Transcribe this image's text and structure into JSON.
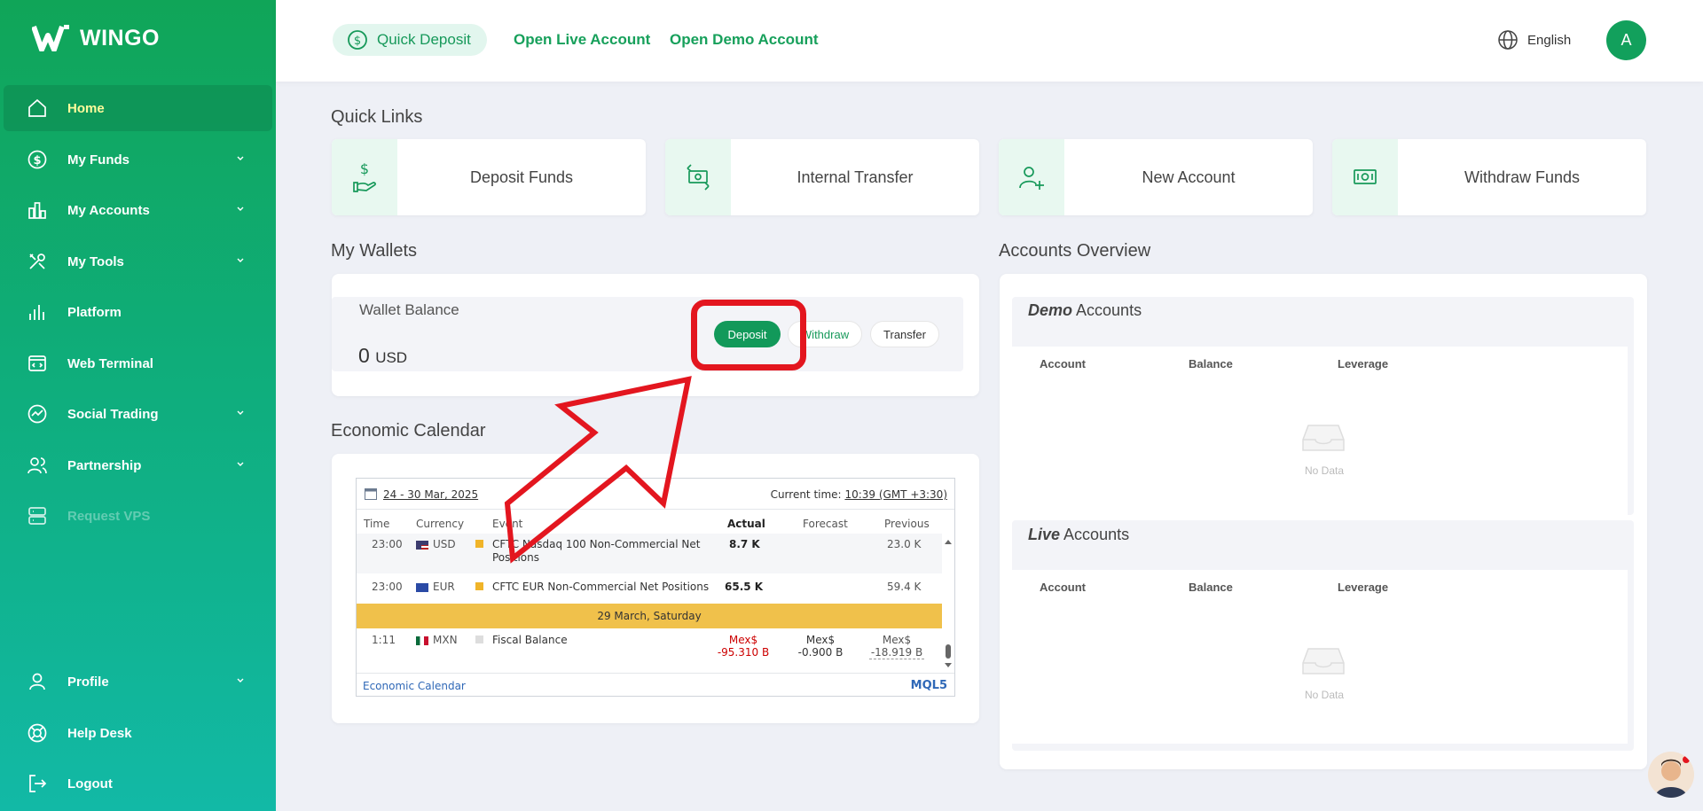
{
  "brand": {
    "name": "WINGO"
  },
  "sidebar": {
    "items": [
      {
        "label": "Home",
        "icon": "home-icon",
        "active": true,
        "expandable": false
      },
      {
        "label": "My Funds",
        "icon": "dollar-circle-icon",
        "expandable": true
      },
      {
        "label": "My Accounts",
        "icon": "bar-chart-icon",
        "expandable": true
      },
      {
        "label": "My Tools",
        "icon": "tools-icon",
        "expandable": true
      },
      {
        "label": "Platform",
        "icon": "signal-bars-icon",
        "expandable": false
      },
      {
        "label": "Web Terminal",
        "icon": "terminal-icon",
        "expandable": false
      },
      {
        "label": "Social Trading",
        "icon": "trend-icon",
        "expandable": true
      },
      {
        "label": "Partnership",
        "icon": "users-icon",
        "expandable": true
      },
      {
        "label": "Request VPS",
        "icon": "server-icon",
        "disabled": true,
        "expandable": false
      },
      {
        "label": "Profile",
        "icon": "user-icon",
        "expandable": true
      },
      {
        "label": "Help Desk",
        "icon": "lifebuoy-icon",
        "expandable": false
      },
      {
        "label": "Logout",
        "icon": "logout-icon",
        "expandable": false
      }
    ]
  },
  "header": {
    "quick_deposit": "Quick Deposit",
    "open_live": "Open Live Account",
    "open_demo": "Open Demo Account",
    "language": "English",
    "avatar_initial": "A"
  },
  "quick_links": {
    "title": "Quick Links",
    "items": [
      {
        "label": "Deposit Funds",
        "icon": "deposit-hand-icon"
      },
      {
        "label": "Internal Transfer",
        "icon": "transfer-icon"
      },
      {
        "label": "New Account",
        "icon": "add-user-icon"
      },
      {
        "label": "Withdraw Funds",
        "icon": "cash-icon"
      }
    ]
  },
  "wallets": {
    "title": "My Wallets",
    "balance_label": "Wallet Balance",
    "balance_amount": "0",
    "balance_currency": "USD",
    "deposit": "Deposit",
    "withdraw": "Withdraw",
    "transfer": "Transfer"
  },
  "calendar": {
    "title": "Economic Calendar",
    "range": "24 - 30 Mar, 2025",
    "current_time_label": "Current time:",
    "current_time": "10:39 (GMT +3:30)",
    "headers": {
      "time": "Time",
      "currency": "Currency",
      "event": "Event",
      "actual": "Actual",
      "forecast": "Forecast",
      "previous": "Previous"
    },
    "rows": [
      {
        "time": "23:00",
        "currency": "USD",
        "event": "CFTC Nasdaq 100 Non-Commercial Net Positions",
        "actual": "8.7 K",
        "forecast": "",
        "previous": "23.0 K"
      },
      {
        "time": "23:00",
        "currency": "EUR",
        "event": "CFTC EUR Non-Commercial Net Positions",
        "actual": "65.5 K",
        "forecast": "",
        "previous": "59.4 K"
      }
    ],
    "date_bar": "29 March, Saturday",
    "row3": {
      "time": "1:11",
      "currency": "MXN",
      "event": "Fiscal Balance",
      "actual_unit": "Mex$",
      "actual": "-95.310 B",
      "forecast_unit": "Mex$",
      "forecast": "-0.900 B",
      "previous_unit": "Mex$",
      "previous": "-18.919 B"
    },
    "footer_link": "Economic Calendar",
    "footer_brand": "MQL5"
  },
  "accounts_overview": {
    "title": "Accounts Overview",
    "demo_title_em": "Demo",
    "live_title_em": "Live",
    "title_suffix": "Accounts",
    "columns": [
      "Account",
      "Balance",
      "Leverage"
    ],
    "no_data": "No Data"
  },
  "colors": {
    "brand_green": "#12995a",
    "annotation_red": "#e3161f",
    "date_bar": "#f0c14b"
  }
}
